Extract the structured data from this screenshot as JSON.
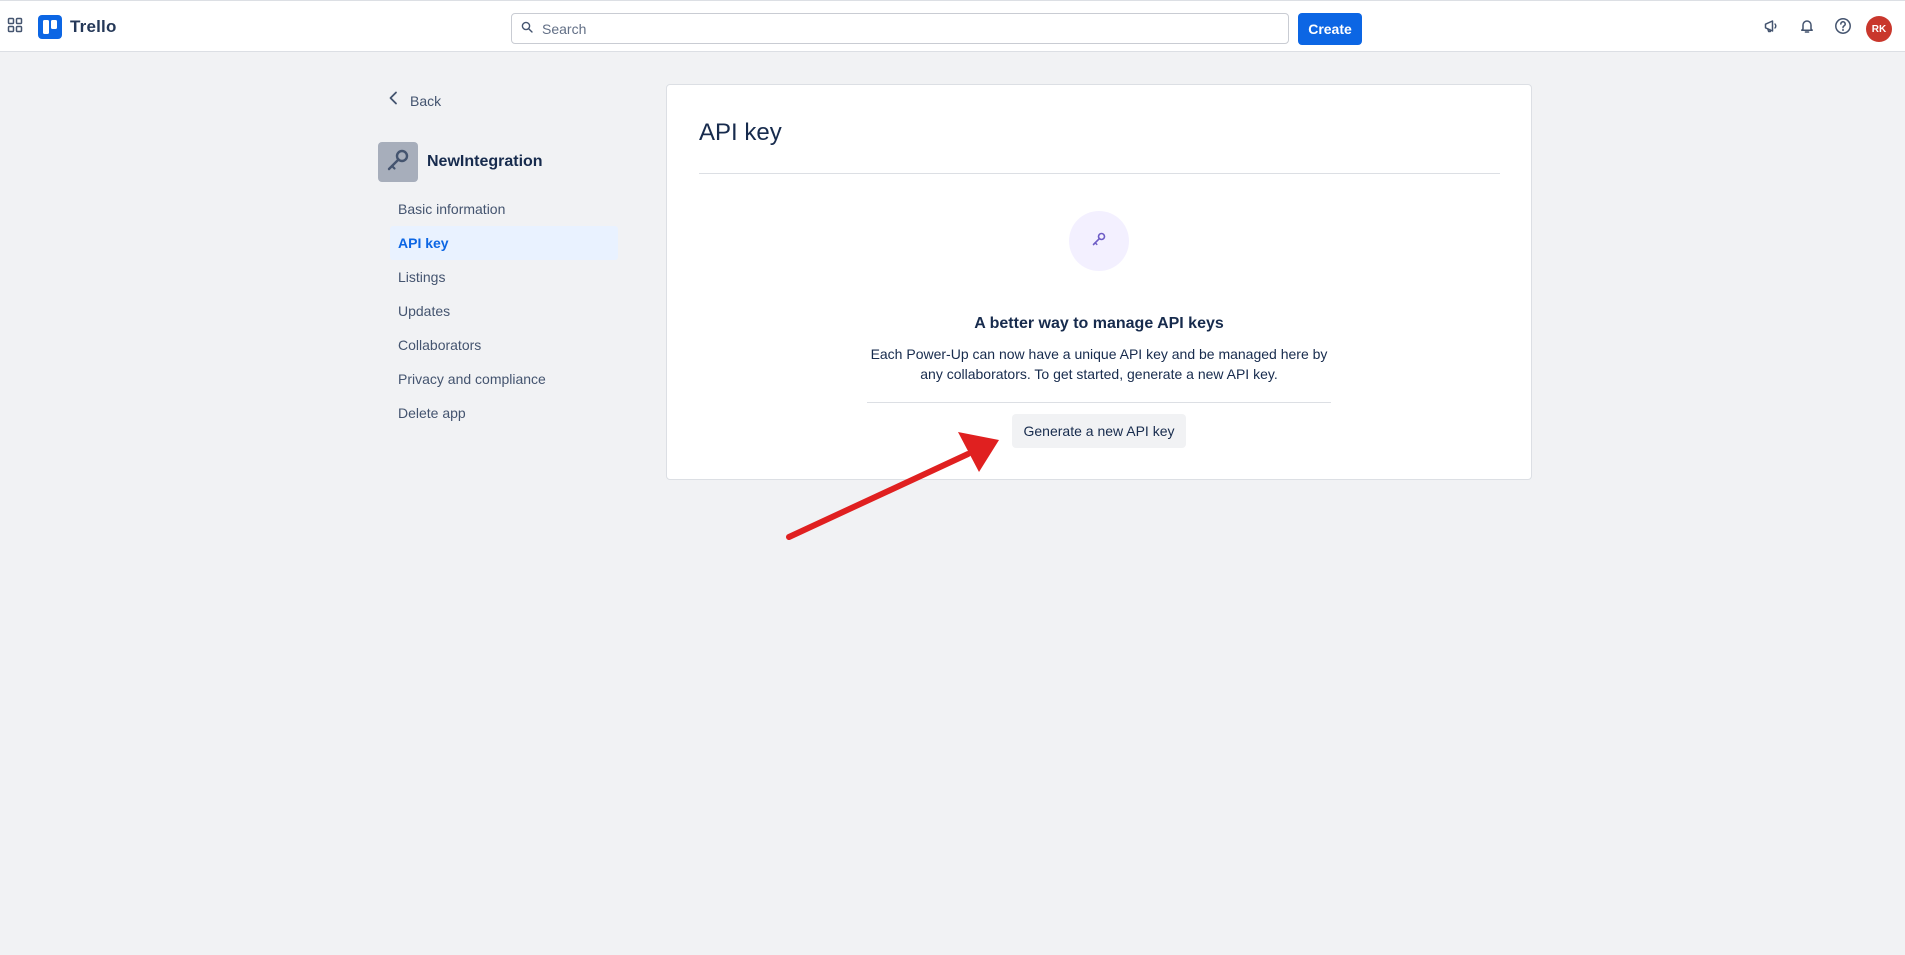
{
  "header": {
    "app_switcher_icon": "grid-icon",
    "logo_text": "Trello",
    "search_placeholder": "Search",
    "create_label": "Create",
    "icons": [
      "megaphone-icon",
      "bell-icon",
      "help-icon"
    ],
    "avatar_initials": "RK"
  },
  "sidebar": {
    "back_label": "Back",
    "app_name": "NewIntegration",
    "items": [
      {
        "label": "Basic information",
        "active": false
      },
      {
        "label": "API key",
        "active": true
      },
      {
        "label": "Listings",
        "active": false
      },
      {
        "label": "Updates",
        "active": false
      },
      {
        "label": "Collaborators",
        "active": false
      },
      {
        "label": "Privacy and compliance",
        "active": false
      },
      {
        "label": "Delete app",
        "active": false
      }
    ]
  },
  "main": {
    "title": "API key",
    "empty_state": {
      "icon": "key-icon",
      "heading": "A better way to manage API keys",
      "description": "Each Power-Up can now have a unique API key and be managed here by any collaborators. To get started, generate a new API key.",
      "button_label": "Generate a new API key"
    }
  },
  "colors": {
    "brand": "#0c66e4",
    "page_bg": "#f1f2f4",
    "avatar": "#c9372c",
    "annotation_arrow": "#e02020"
  }
}
